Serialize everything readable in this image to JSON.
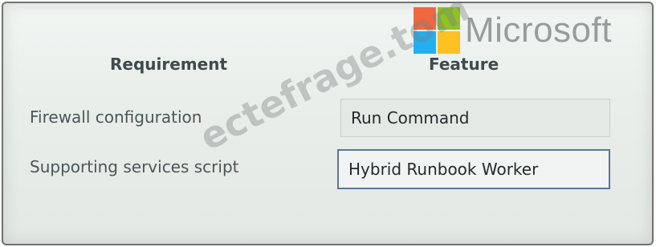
{
  "headers": {
    "requirement": "Requirement",
    "feature": "Feature"
  },
  "rows": [
    {
      "label": "Firewall configuration",
      "answer": "Run Command"
    },
    {
      "label": "Supporting services script",
      "answer": "Hybrid Runbook Worker"
    }
  ],
  "logo": {
    "text": "Microsoft",
    "colors": [
      "#f25022",
      "#7fba00",
      "#00a4ef",
      "#ffb900"
    ]
  },
  "watermark": "ectefrage.tom"
}
